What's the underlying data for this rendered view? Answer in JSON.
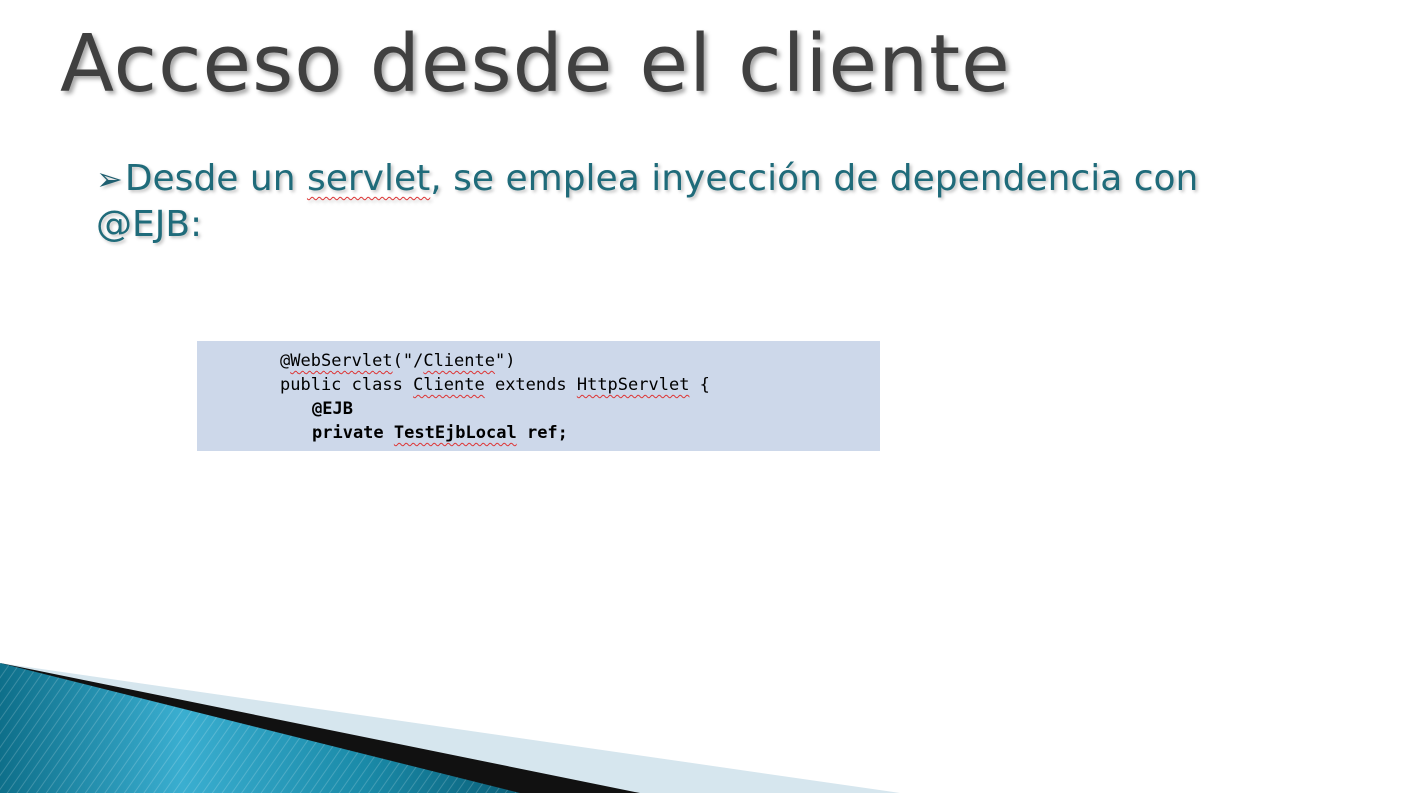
{
  "slide": {
    "title": "Acceso desde el cliente",
    "bullet": {
      "arrow": "➢",
      "part1": "Desde un ",
      "servlet_word": "servlet",
      "part2": ", se emplea inyección de dependencia con",
      "line2": "@EJB:"
    },
    "code": {
      "line1": {
        "at": "@",
        "name": "WebServlet",
        "open": "(\"/",
        "arg": "Cliente",
        "close": "\")"
      },
      "line2": {
        "p1": "public class ",
        "cls": "Cliente",
        "p2": " extends ",
        "base": "HttpServlet",
        "p3": " {"
      },
      "line3": "@EJB",
      "line4": {
        "p1": "private ",
        "type": "TestEjbLocal",
        "p2": " ref;"
      }
    }
  },
  "colors": {
    "title": "#404040",
    "bullet": "#1f6b7a",
    "code_bg": "#cdd8ea",
    "decor_teal": "#1a8aa8",
    "decor_light": "#d6e6ee"
  }
}
